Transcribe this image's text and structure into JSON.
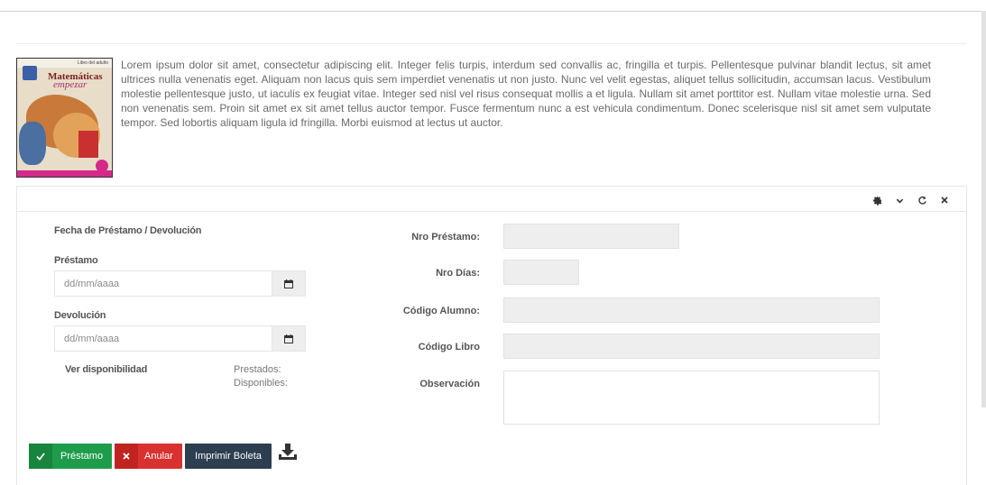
{
  "intro": {
    "text": "Lorem ipsum dolor sit amet, consectetur adipiscing elit. Integer felis turpis, interdum sed convallis ac, fringilla et turpis. Pellentesque pulvinar blandit lectus, sit amet ultrices nulla venenatis eget. Aliquam non lacus quis sem imperdiet venenatis ut non justo. Nunc vel velit egestas, aliquet tellus sollicitudin, accumsan lacus. Vestibulum molestie pellentesque justo, ut iaculis ex feugiat vitae. Integer sed nisl vel risus consequat mollis a et ligula. Nullam sit amet porttitor est. Nullam vitae molestie urna. Sed non venenatis sem. Proin sit amet ex sit amet tellus auctor tempor. Fusce fermentum nunc a est vehicula condimentum. Donec scelerisque nisl sit amet sem vulputate tempor. Sed lobortis aliquam ligula id fringilla. Morbi euismod at lectus ut auctor.",
    "cover": {
      "title_line1": "Matemáticas",
      "title_line2": "empezar",
      "tag": "Libro del adulto"
    }
  },
  "panel": {
    "tools": [
      "gear-icon",
      "chevron-down-icon",
      "refresh-icon",
      "close-icon"
    ]
  },
  "form": {
    "dates_heading": "Fecha de Préstamo / Devolución",
    "prestamo_label": "Préstamo",
    "prestamo_placeholder": "dd/mm/aaaa",
    "devolucion_label": "Devolución",
    "devolucion_placeholder": "dd/mm/aaaa",
    "ver_disponibilidad": "Ver disponibilidad",
    "prestados_label": "Prestados:",
    "disponibles_label": "Disponibles:",
    "nro_prestamo_label": "Nro Préstamo:",
    "nro_dias_label": "Nro Días:",
    "codigo_alumno_label": "Código Alumno:",
    "codigo_libro_label": "Código Libro",
    "observacion_label": "Observación"
  },
  "actions": {
    "prestamo_button": "Préstamo",
    "anular_button": "Anular",
    "imprimir_button": "Imprimir Boleta"
  },
  "colors": {
    "success": "#1f9c4b",
    "danger": "#d9312f",
    "dark": "#2c3e50"
  }
}
